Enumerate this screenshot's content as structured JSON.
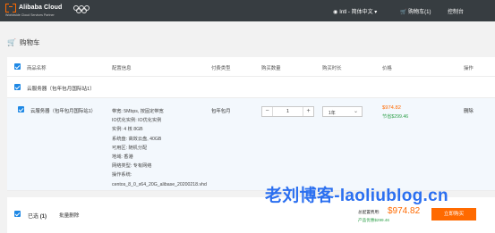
{
  "header": {
    "logo_text": "Alibaba Cloud",
    "logo_sub": "Worldwide Cloud Services Partner",
    "lang": "Intl - 简体中文",
    "cart": "购物车(1)",
    "console": "控制台"
  },
  "page": {
    "title": "购物车"
  },
  "table": {
    "headers": [
      "商品名称",
      "配置信息",
      "付费类型",
      "购买数量",
      "购买时长",
      "价格",
      "操作"
    ],
    "group_label": "云服务器（包年包月国际站1）",
    "item": {
      "name": "云服务器（包年包月国际站1）",
      "specs": [
        "带宽: 5Mbps, 按固定带宽",
        "IO优化实例: IO优化实例",
        "实例: 4 核 8GB",
        "系统盘: 高效云盘, 40GB",
        "可用区: 随机分配",
        "地域: 香港",
        "网络类型: 专有网络",
        "操作系统:",
        "centos_8_0_x64_20G_alibase_20200218.vhd"
      ],
      "pay_type": "包年包月",
      "quantity": "1",
      "duration": "1年",
      "price": "$974.82",
      "saved": "节省$299.46",
      "action": "删除"
    }
  },
  "footer": {
    "selected_label": "已选",
    "selected_count": "(1)",
    "batch_delete": "批量删除",
    "total_label": "总配置费用:",
    "total_value": "$974.82",
    "total_saved": "产品优惠$299.46",
    "checkout": "立即购买"
  },
  "watermark": "老刘博客-laoliublog.cn",
  "colors": {
    "accent": "#ff6a00",
    "checkbox": "#1e88e5",
    "saved": "#2fa04a",
    "topbar": "#373d41",
    "watermark": "#2b6ff0"
  }
}
